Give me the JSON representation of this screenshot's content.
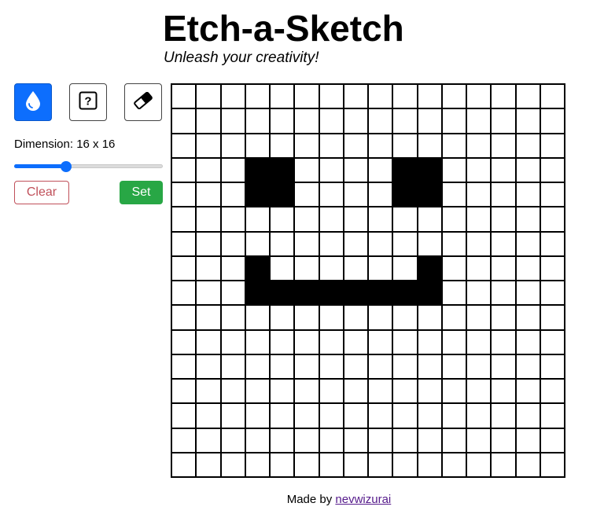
{
  "header": {
    "title": "Etch-a-Sketch",
    "subtitle": "Unleash your creativity!"
  },
  "tools": {
    "color_icon": "water-drop-icon",
    "random_icon": "question-box-icon",
    "eraser_icon": "eraser-icon",
    "active_tool": "color",
    "active_color": "#0d6efd"
  },
  "controls": {
    "dimension_label": "Dimension: 16 x 16",
    "slider_value": 16,
    "slider_min": 2,
    "slider_max": 64,
    "clear_label": "Clear",
    "set_label": "Set",
    "clear_color": "#c0505a",
    "set_color": "#28a745"
  },
  "grid": {
    "size": 16,
    "filled_cells": [
      [
        3,
        3
      ],
      [
        3,
        4
      ],
      [
        3,
        9
      ],
      [
        3,
        10
      ],
      [
        4,
        3
      ],
      [
        4,
        4
      ],
      [
        4,
        9
      ],
      [
        4,
        10
      ],
      [
        7,
        3
      ],
      [
        7,
        10
      ],
      [
        8,
        3
      ],
      [
        8,
        4
      ],
      [
        8,
        5
      ],
      [
        8,
        6
      ],
      [
        8,
        7
      ],
      [
        8,
        8
      ],
      [
        8,
        9
      ],
      [
        8,
        10
      ]
    ]
  },
  "footer": {
    "prefix": "Made by ",
    "author": "nevwizurai"
  }
}
